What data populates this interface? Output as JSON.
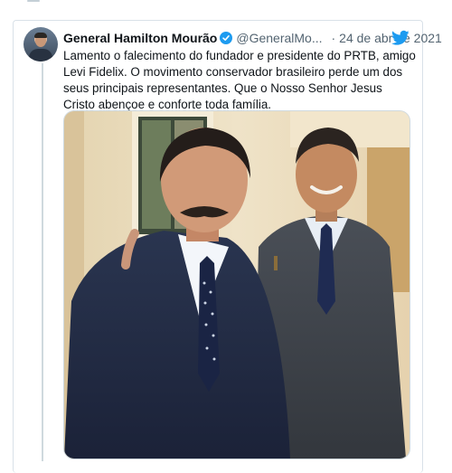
{
  "tweet": {
    "author_name": "General Hamilton Mourão",
    "author_handle": "@GeneralMo...",
    "separator": "·",
    "date": "24 de abr de 2021",
    "text": "Lamento o falecimento do fundador e presidente do PRTB, amigo Levi Fidelix. O movimento conservador brasileiro perde um dos seus principais representantes. Que o Nosso Senhor Jesus Cristo abençoe e conforte toda família.",
    "verified_icon": "verified-badge-icon",
    "platform_icon": "twitter-bird-icon",
    "photo_description_icon": "photo-two-men-in-suits"
  },
  "colors": {
    "accent": "#1d9bf0",
    "text": "#0f1419",
    "secondary_text": "#536471",
    "border": "#cfd9de"
  }
}
